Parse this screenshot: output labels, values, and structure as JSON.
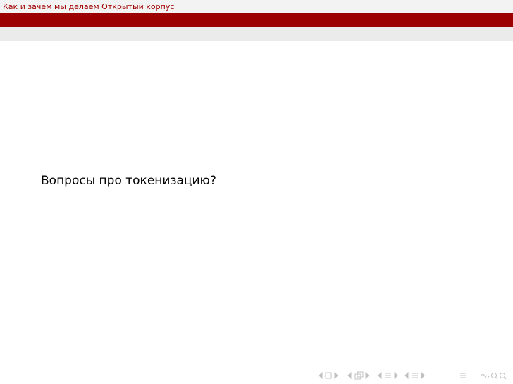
{
  "header": {
    "title": "Как и зачем мы делаем Открытый корпус"
  },
  "slide": {
    "body_text": "Вопросы про токенизацию?"
  },
  "colors": {
    "accent": "#9c0000",
    "header_text": "#a00000",
    "header_bg": "#f3f3f3",
    "subtitle_band": "#ebebeb",
    "nav_symbol": "#c0c0c0"
  },
  "navigation": {
    "icons": [
      "left-arrow-icon",
      "frame-icon",
      "right-arrow-icon",
      "left-arrow-icon",
      "subsection-icon",
      "right-arrow-icon",
      "left-arrow-icon",
      "section-icon",
      "right-arrow-icon",
      "left-arrow-icon",
      "outline-icon",
      "right-arrow-icon",
      "align-icon",
      "search-icon"
    ]
  }
}
